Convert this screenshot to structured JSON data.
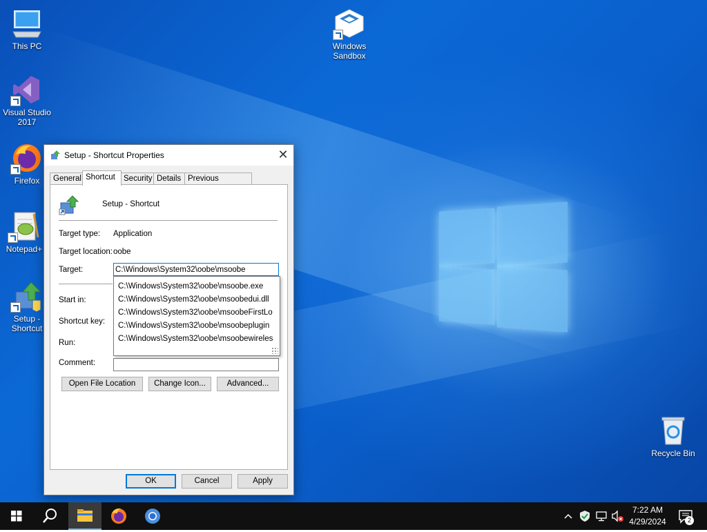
{
  "desktop": {
    "icons": [
      {
        "label": "This PC",
        "icon": "this-pc-icon"
      },
      {
        "label": "Visual Studio 2017",
        "icon": "visual-studio-icon"
      },
      {
        "label": "Firefox",
        "icon": "firefox-icon"
      },
      {
        "label": "Notepad+",
        "icon": "notepad-plus-icon"
      },
      {
        "label": "Setup - Shortcut",
        "icon": "setup-icon"
      },
      {
        "label": "Windows Sandbox",
        "icon": "sandbox-icon"
      },
      {
        "label": "Recycle Bin",
        "icon": "recycle-bin-icon"
      }
    ]
  },
  "dialog": {
    "title": "Setup - Shortcut Properties",
    "close_glyph": "✕",
    "tabs": [
      "General",
      "Shortcut",
      "Security",
      "Details",
      "Previous Versions"
    ],
    "active_tab": "Shortcut",
    "name": "Setup - Shortcut",
    "fields": {
      "target_type_label": "Target type:",
      "target_type_value": "Application",
      "target_location_label": "Target location:",
      "target_location_value": "oobe",
      "target_label": "Target:",
      "target_value": "C:\\Windows\\System32\\oobe\\msoobe",
      "start_in_label": "Start in:",
      "shortcut_key_label": "Shortcut key:",
      "run_label": "Run:",
      "comment_label": "Comment:"
    },
    "suggestions": [
      "C:\\Windows\\System32\\oobe\\msoobe.exe",
      "C:\\Windows\\System32\\oobe\\msoobedui.dll",
      "C:\\Windows\\System32\\oobe\\msoobeFirstLo",
      "C:\\Windows\\System32\\oobe\\msoobeplugin",
      "C:\\Windows\\System32\\oobe\\msoobewireles"
    ],
    "buttons": {
      "open_file_location": "Open File Location",
      "change_icon": "Change Icon...",
      "advanced": "Advanced...",
      "ok": "OK",
      "cancel": "Cancel",
      "apply": "Apply"
    }
  },
  "taskbar": {
    "pinned": [
      "windows-start-icon",
      "search-icon",
      "file-explorer-icon",
      "firefox-icon",
      "chrome-icon"
    ],
    "tray": {
      "time": "7:22 AM",
      "date": "4/29/2024",
      "notification_count": "2"
    }
  },
  "colors": {
    "accent": "#0078d7",
    "taskbar": "#101010",
    "desktop": "#0b69d6"
  }
}
